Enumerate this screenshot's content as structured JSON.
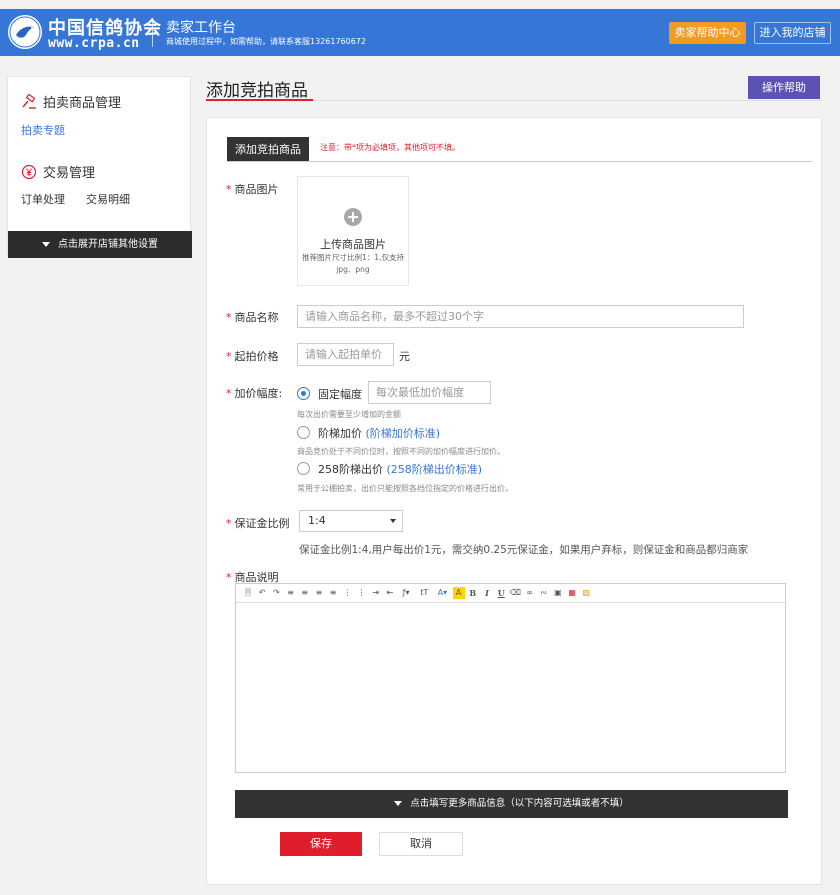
{
  "header": {
    "logo_cn": "中国信鸽协会",
    "logo_url": "www.crpa.cn",
    "title": "卖家工作台",
    "subtitle": "商城使用过程中，如需帮助，请联系客服13261760672",
    "help_center_label": "卖家帮助中心",
    "my_shop_label": "进入我的店铺",
    "bg_color": "#3576d6",
    "help_center_color": "#f39a21"
  },
  "sidebar": {
    "section1": {
      "icon": "auction-hammer-icon",
      "label": "拍卖商品管理"
    },
    "section1_link": "拍卖专题",
    "section2": {
      "icon": "yuan-circle-icon",
      "label": "交易管理"
    },
    "section2_items": [
      "订单处理",
      "交易明细"
    ],
    "expand_label": "点击展开店铺其他设置"
  },
  "page": {
    "title": "添加竞拍商品",
    "op_help_label": "操作帮助",
    "accent_color": "#d9232d"
  },
  "form": {
    "tab_label": "添加竞拍商品",
    "notice": "注意：带*项为必填项，其他项可不填。",
    "image": {
      "label": "商品图片",
      "upload_title": "上传商品图片",
      "upload_hint": "推荐图片尺寸比例1：1,仅支持jpg、png"
    },
    "name": {
      "label": "商品名称",
      "placeholder": "请输入商品名称，最多不超过30个字"
    },
    "start_price": {
      "label": "起拍价格",
      "placeholder": "请输入起拍单价",
      "unit": "元"
    },
    "increment": {
      "label": "加价幅度:",
      "options": [
        {
          "label": "固定幅度",
          "selected": true,
          "input_placeholder": "每次最低加价幅度",
          "hint": "每次出价需要至少增加的金额"
        },
        {
          "label": "阶梯加价",
          "link": "(阶梯加价标准)",
          "selected": false,
          "hint": "商品竞价处于不同价位时，按照不同的加价幅度进行加价。"
        },
        {
          "label": "258阶梯出价",
          "link": "(258阶梯出价标准)",
          "selected": false,
          "hint": "常用于公棚拍卖，出价只能按照各档位指定的价格进行出价。"
        }
      ]
    },
    "deposit": {
      "label": "保证金比例",
      "selected": "1:4",
      "description": "保证金比例1:4,用户每出价1元，需交纳0.25元保证金，如果用户弃标，则保证金和商品都归商家"
    },
    "description": {
      "label": "商品说明"
    },
    "toolbar_icons": [
      "source-icon",
      "undo-icon",
      "redo-icon",
      "align-left-icon",
      "align-center-icon",
      "align-right-icon",
      "align-justify-icon",
      "ordered-list-icon",
      "unordered-list-icon",
      "indent-icon",
      "outdent-icon",
      "font-family-icon",
      "font-size-icon",
      "font-color-icon",
      "background-color-icon",
      "bold-icon",
      "italic-icon",
      "underline-icon",
      "clear-format-icon",
      "link-icon",
      "unlink-icon",
      "image-icon",
      "table-icon",
      "emoticon-icon"
    ],
    "more_info_label": "点击填写更多商品信息（以下内容可选填或者不填）",
    "save_label": "保存",
    "cancel_label": "取消"
  }
}
